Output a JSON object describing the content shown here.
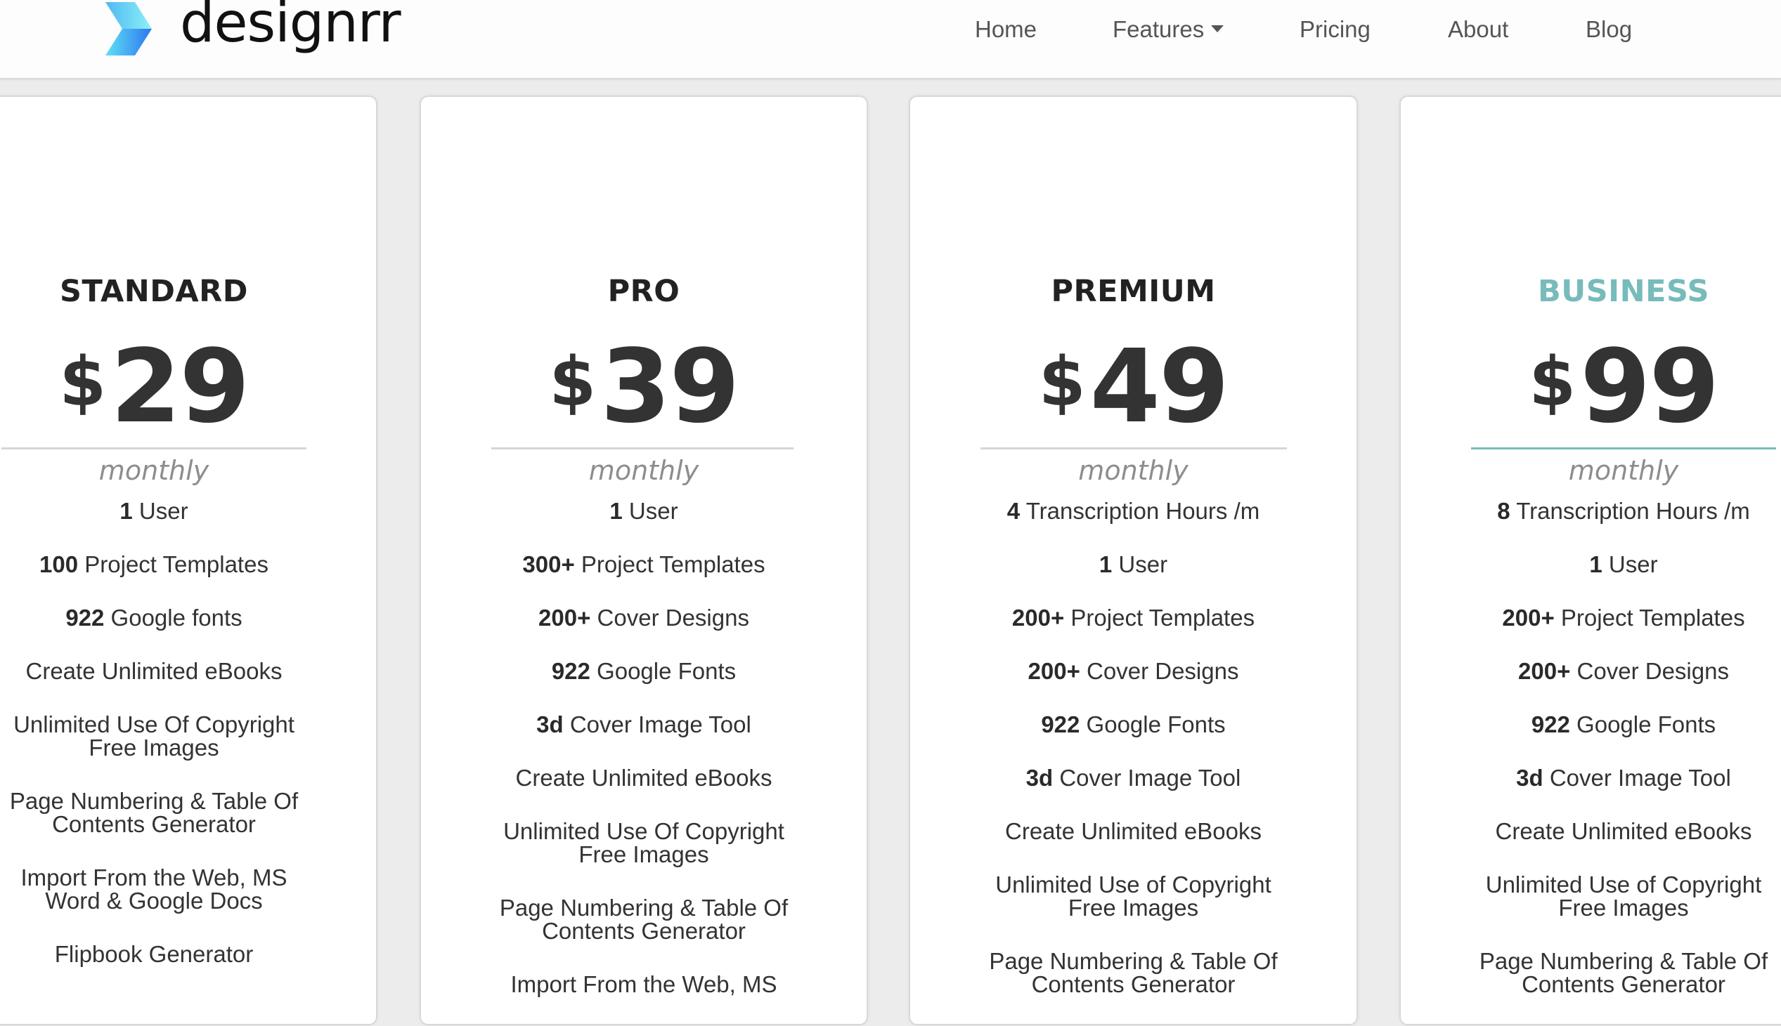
{
  "brand": {
    "name": "designrr",
    "logo_colors": {
      "top": "#7fe3f6",
      "bottom": "#2f80f0"
    }
  },
  "nav": {
    "items": [
      {
        "label": "Home"
      },
      {
        "label": "Features",
        "has_dropdown": true,
        "icon": "caret-down-icon"
      },
      {
        "label": "Pricing"
      },
      {
        "label": "About"
      },
      {
        "label": "Blog"
      }
    ]
  },
  "accent_color": "#77bbbb",
  "plans": [
    {
      "name": "STANDARD",
      "currency": "$",
      "price": "29",
      "period": "monthly",
      "features": [
        {
          "bold": "1",
          "text": " User"
        },
        {
          "bold": "100",
          "text": " Project Templates"
        },
        {
          "bold": "922",
          "text": " Google fonts"
        },
        {
          "bold": "",
          "text": "Create Unlimited eBooks"
        },
        {
          "bold": "",
          "text": "Unlimited Use Of Copyright",
          "text2": "Free Images"
        },
        {
          "bold": "",
          "text": "Page Numbering & Table Of",
          "text2": "Contents Generator"
        },
        {
          "bold": "",
          "text": "Import From the Web, MS",
          "text2": "Word & Google Docs"
        },
        {
          "bold": "",
          "text": "Flipbook Generator"
        }
      ]
    },
    {
      "name": "PRO",
      "currency": "$",
      "price": "39",
      "period": "monthly",
      "features": [
        {
          "bold": "1",
          "text": " User"
        },
        {
          "bold": "300+",
          "text": " Project Templates"
        },
        {
          "bold": "200+",
          "text": " Cover Designs"
        },
        {
          "bold": "922",
          "text": " Google Fonts"
        },
        {
          "bold": "3d",
          "text": " Cover Image Tool"
        },
        {
          "bold": "",
          "text": "Create Unlimited eBooks"
        },
        {
          "bold": "",
          "text": "Unlimited Use Of Copyright",
          "text2": "Free Images"
        },
        {
          "bold": "",
          "text": "Page Numbering & Table Of",
          "text2": "Contents Generator"
        },
        {
          "bold": "",
          "text": "Import From the Web, MS"
        }
      ]
    },
    {
      "name": "PREMIUM",
      "currency": "$",
      "price": "49",
      "period": "monthly",
      "features": [
        {
          "bold": "4",
          "text": " Transcription Hours /m"
        },
        {
          "bold": "1",
          "text": " User"
        },
        {
          "bold": "200+",
          "text": " Project Templates"
        },
        {
          "bold": "200+",
          "text": " Cover Designs"
        },
        {
          "bold": "922",
          "text": " Google Fonts"
        },
        {
          "bold": "3d",
          "text": " Cover Image Tool"
        },
        {
          "bold": "",
          "text": "Create Unlimited eBooks"
        },
        {
          "bold": "",
          "text": "Unlimited Use of Copyright",
          "text2": "Free Images"
        },
        {
          "bold": "",
          "text": "Page Numbering & Table Of",
          "text2": "Contents Generator"
        }
      ]
    },
    {
      "name": "BUSINESS",
      "highlighted": true,
      "currency": "$",
      "price": "99",
      "period": "monthly",
      "features": [
        {
          "bold": "8",
          "text": " Transcription Hours /m"
        },
        {
          "bold": "1",
          "text": " User"
        },
        {
          "bold": "200+",
          "text": " Project Templates"
        },
        {
          "bold": "200+",
          "text": " Cover Designs"
        },
        {
          "bold": "922",
          "text": " Google Fonts"
        },
        {
          "bold": "3d",
          "text": " Cover Image Tool"
        },
        {
          "bold": "",
          "text": "Create Unlimited eBooks"
        },
        {
          "bold": "",
          "text": "Unlimited Use of Copyright",
          "text2": "Free Images"
        },
        {
          "bold": "",
          "text": "Page Numbering & Table Of",
          "text2": "Contents Generator"
        }
      ]
    }
  ]
}
